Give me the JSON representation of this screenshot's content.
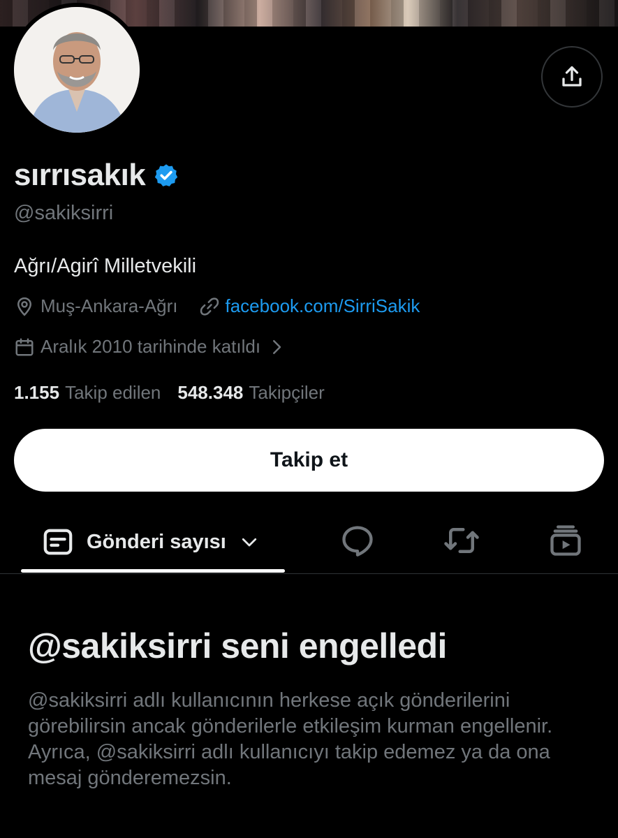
{
  "profile": {
    "display_name": "sırrısakık",
    "handle": "@sakiksirri",
    "bio": "Ağrı/Agirî Milletvekili",
    "location": "Muş-Ankara-Ağrı",
    "website": "facebook.com/SirriSakik",
    "joined": "Aralık 2010 tarihinde katıldı",
    "following_count": "1.155",
    "following_label": "Takip edilen",
    "followers_count": "548.348",
    "followers_label": "Takipçiler",
    "verified": true
  },
  "actions": {
    "follow_label": "Takip et"
  },
  "tabs": {
    "posts_label": "Gönderi sayısı"
  },
  "blocked": {
    "title": "@sakiksirri seni engelledi",
    "message": "@sakiksirri adlı kullanıcının herkese açık gönderilerini görebilirsin ancak gönderilerle etkileşim kurman engellenir. Ayrıca, @sakiksirri adlı kullanıcıyı takip edemez ya da ona mesaj gönderemezsin."
  },
  "colors": {
    "background": "#000000",
    "text_primary": "#e7e9ea",
    "text_secondary": "#71767b",
    "link": "#1d9bf0",
    "verified": "#1d9bf0"
  },
  "icons": [
    "share-icon",
    "verified-badge-icon",
    "location-icon",
    "link-icon",
    "calendar-icon",
    "chevron-right-icon",
    "posts-icon",
    "chevron-down-icon",
    "reply-icon",
    "repost-icon",
    "media-icon"
  ]
}
